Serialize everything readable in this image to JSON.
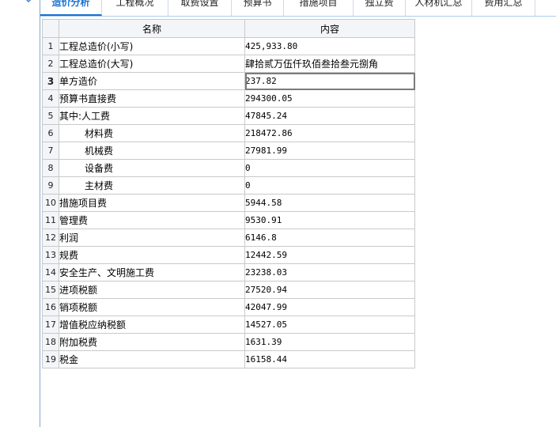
{
  "tabs": [
    {
      "label": "造价分析",
      "active": true
    },
    {
      "label": "工程概况",
      "active": false
    },
    {
      "label": "取费设置",
      "active": false
    },
    {
      "label": "预算书",
      "active": false
    },
    {
      "label": "措施项目",
      "active": false
    },
    {
      "label": "独立费",
      "active": false
    },
    {
      "label": "人材机汇总",
      "active": false
    },
    {
      "label": "费用汇总",
      "active": false
    }
  ],
  "table": {
    "headers": {
      "name": "名称",
      "content": "内容"
    },
    "selected_row": 3,
    "rows": [
      {
        "no": "1",
        "name": "工程总造价(小写)",
        "value": "425,933.80"
      },
      {
        "no": "2",
        "name": "工程总造价(大写)",
        "value": "肆拾贰万伍仟玖佰叁拾叁元捌角"
      },
      {
        "no": "3",
        "name": "单方造价",
        "value": "237.82"
      },
      {
        "no": "4",
        "name": "预算书直接费",
        "value": "294300.05"
      },
      {
        "no": "5",
        "name": "其中:人工费",
        "value": "47845.24"
      },
      {
        "no": "6",
        "name": "材料费",
        "value": "218472.86"
      },
      {
        "no": "7",
        "name": "机械费",
        "value": "27981.99"
      },
      {
        "no": "8",
        "name": "设备费",
        "value": "0"
      },
      {
        "no": "9",
        "name": "主材费",
        "value": "0"
      },
      {
        "no": "10",
        "name": "措施项目费",
        "value": "5944.58"
      },
      {
        "no": "11",
        "name": "管理费",
        "value": "9530.91"
      },
      {
        "no": "12",
        "name": "利润",
        "value": "6146.8"
      },
      {
        "no": "13",
        "name": "规费",
        "value": "12442.59"
      },
      {
        "no": "14",
        "name": "安全生产、文明施工费",
        "value": "23238.03"
      },
      {
        "no": "15",
        "name": "进项税额",
        "value": "27520.94"
      },
      {
        "no": "16",
        "name": "销项税额",
        "value": "42047.99"
      },
      {
        "no": "17",
        "name": "增值税应纳税额",
        "value": "14527.05"
      },
      {
        "no": "18",
        "name": "附加税费",
        "value": "1631.39"
      },
      {
        "no": "19",
        "name": "税金",
        "value": "16158.44"
      }
    ]
  }
}
